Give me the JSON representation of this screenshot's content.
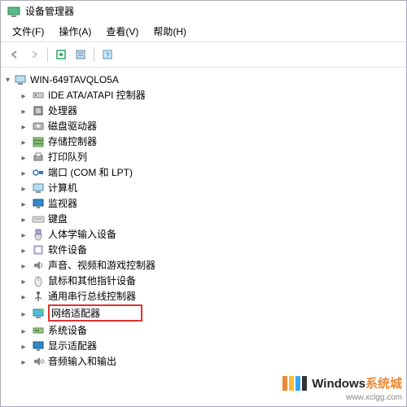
{
  "title": "设备管理器",
  "menu": {
    "file": "文件(F)",
    "action": "操作(A)",
    "view": "查看(V)",
    "help": "帮助(H)"
  },
  "root_name": "WIN-649TAVQLO5A",
  "items": [
    {
      "name": "ide",
      "label": "IDE ATA/ATAPI 控制器"
    },
    {
      "name": "cpu",
      "label": "处理器"
    },
    {
      "name": "disk",
      "label": "磁盘驱动器"
    },
    {
      "name": "storage",
      "label": "存储控制器"
    },
    {
      "name": "printq",
      "label": "打印队列"
    },
    {
      "name": "ports",
      "label": "端口 (COM 和 LPT)"
    },
    {
      "name": "computer",
      "label": "计算机"
    },
    {
      "name": "monitor",
      "label": "监视器"
    },
    {
      "name": "keyboard",
      "label": "键盘"
    },
    {
      "name": "hid",
      "label": "人体学输入设备"
    },
    {
      "name": "software",
      "label": "软件设备"
    },
    {
      "name": "sound",
      "label": "声音、视频和游戏控制器"
    },
    {
      "name": "mouse",
      "label": "鼠标和其他指针设备"
    },
    {
      "name": "usb",
      "label": "通用串行总线控制器"
    },
    {
      "name": "network",
      "label": "网络适配器",
      "highlight": true
    },
    {
      "name": "system",
      "label": "系统设备"
    },
    {
      "name": "display",
      "label": "显示适配器"
    },
    {
      "name": "audio",
      "label": "音频输入和输出"
    }
  ],
  "watermark": {
    "brand_prefix": "Windows",
    "brand_suffix": "系统城",
    "url": "www.xclgg.com"
  }
}
